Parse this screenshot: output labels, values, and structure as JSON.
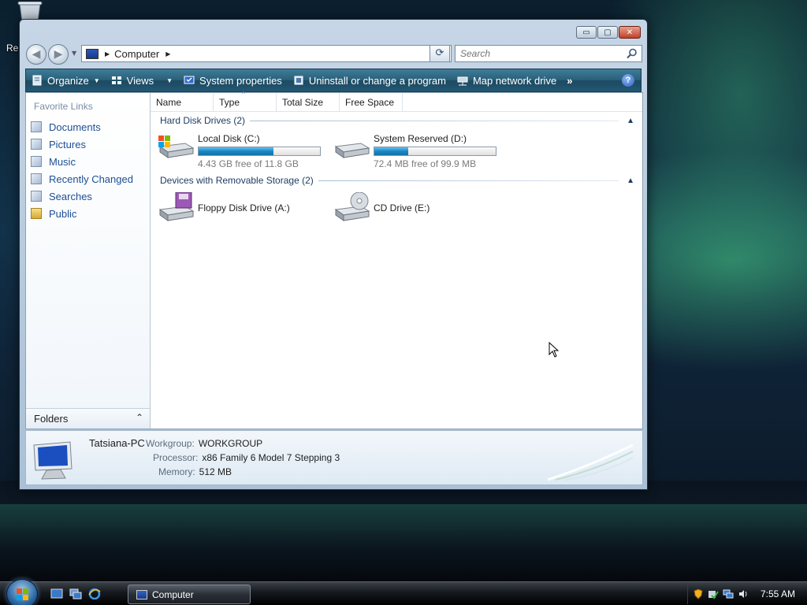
{
  "desktop": {
    "recycle_label": "Re"
  },
  "window": {
    "caption_buttons": {
      "minimize": "▭",
      "maximize": "▢",
      "close": "✕"
    },
    "address": {
      "location": "Computer"
    },
    "search": {
      "placeholder": "Search"
    },
    "toolbar": {
      "organize": "Organize",
      "views": "Views",
      "system_properties": "System properties",
      "uninstall": "Uninstall or change a program",
      "map_drive": "Map network drive",
      "more": "»",
      "help": "?"
    },
    "nav_pane": {
      "title": "Favorite Links",
      "items": [
        {
          "label": "Documents",
          "icon": "documents-icon"
        },
        {
          "label": "Pictures",
          "icon": "pictures-icon"
        },
        {
          "label": "Music",
          "icon": "music-icon"
        },
        {
          "label": "Recently Changed",
          "icon": "recently-changed-icon"
        },
        {
          "label": "Searches",
          "icon": "searches-icon"
        },
        {
          "label": "Public",
          "icon": "public-folder-icon"
        }
      ],
      "folders_label": "Folders"
    },
    "columns": [
      "Name",
      "Type",
      "Total Size",
      "Free Space"
    ],
    "groups": [
      {
        "title": "Hard Disk Drives (2)",
        "drives": [
          {
            "name": "Local Disk (C:)",
            "free": "4.43 GB free of 11.8 GB",
            "used_fraction": 0.62
          },
          {
            "name": "System Reserved (D:)",
            "free": "72.4 MB free of 99.9 MB",
            "used_fraction": 0.28
          }
        ]
      },
      {
        "title": "Devices with Removable Storage (2)",
        "drives": [
          {
            "name": "Floppy Disk Drive (A:)"
          },
          {
            "name": "CD Drive (E:)"
          }
        ]
      }
    ],
    "details": {
      "computer_name": "Tatsiana-PC",
      "workgroup_label": "Workgroup:",
      "workgroup": "WORKGROUP",
      "processor_label": "Processor:",
      "processor": "x86 Family 6 Model 7 Stepping 3",
      "memory_label": "Memory:",
      "memory": "512 MB"
    }
  },
  "taskbar": {
    "task_button": "Computer",
    "clock": "7:55 AM"
  },
  "colors": {
    "toolbar": "#2a5f79",
    "link": "#1d4f93",
    "drive_fill": "#1b86c2"
  }
}
